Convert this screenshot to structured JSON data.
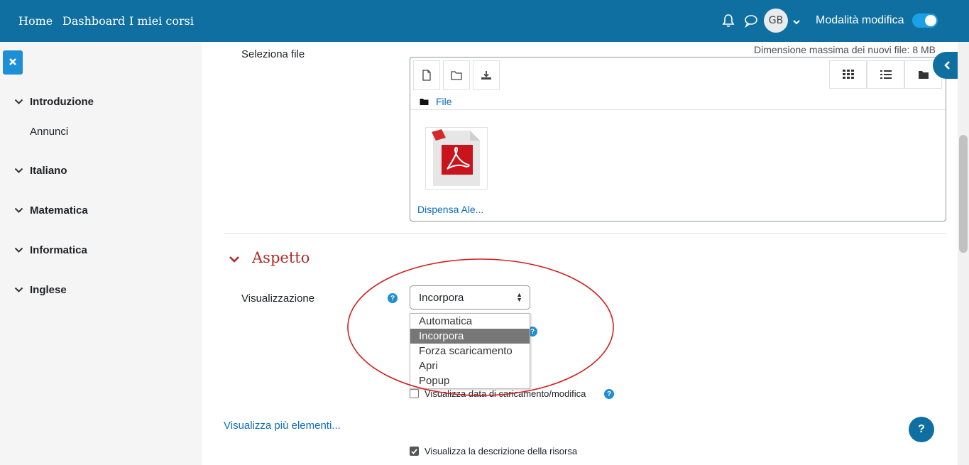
{
  "navbar": {
    "home": "Home",
    "dashboard": "Dashboard",
    "my_courses": "I miei corsi",
    "avatar_initials": "GB",
    "edit_mode_label": "Modalità modifica",
    "edit_mode_on": true,
    "color": "#0f6fa0"
  },
  "sidebar": {
    "sections": [
      {
        "label": "Introduzione",
        "items": [
          "Annunci"
        ]
      },
      {
        "label": "Italiano",
        "items": []
      },
      {
        "label": "Matematica",
        "items": []
      },
      {
        "label": "Informatica",
        "items": []
      },
      {
        "label": "Inglese",
        "items": []
      }
    ]
  },
  "file_picker": {
    "label": "Seleziona file",
    "max_size": "Dimensione massima dei nuovi file: 8 MB",
    "path": "File",
    "file_name": "Dispensa Ale..."
  },
  "appearance": {
    "title": "Aspetto",
    "display_label": "Visualizzazione",
    "display_value": "Incorpora",
    "options": [
      "Automatica",
      "Incorpora",
      "Forza scaricamento",
      "Apri",
      "Popup"
    ],
    "selected_index": 1,
    "show_upload_date": "Visualizza data di caricamento/modifica",
    "show_more": "Visualizza più elementi...",
    "show_description": "Visualizza la descrizione della risorsa"
  },
  "help_button": "?",
  "colors": {
    "accent": "#1e8ed6",
    "link": "#0f6cbf",
    "section_title": "#b02a2a",
    "annotation": "#d11f1f"
  }
}
